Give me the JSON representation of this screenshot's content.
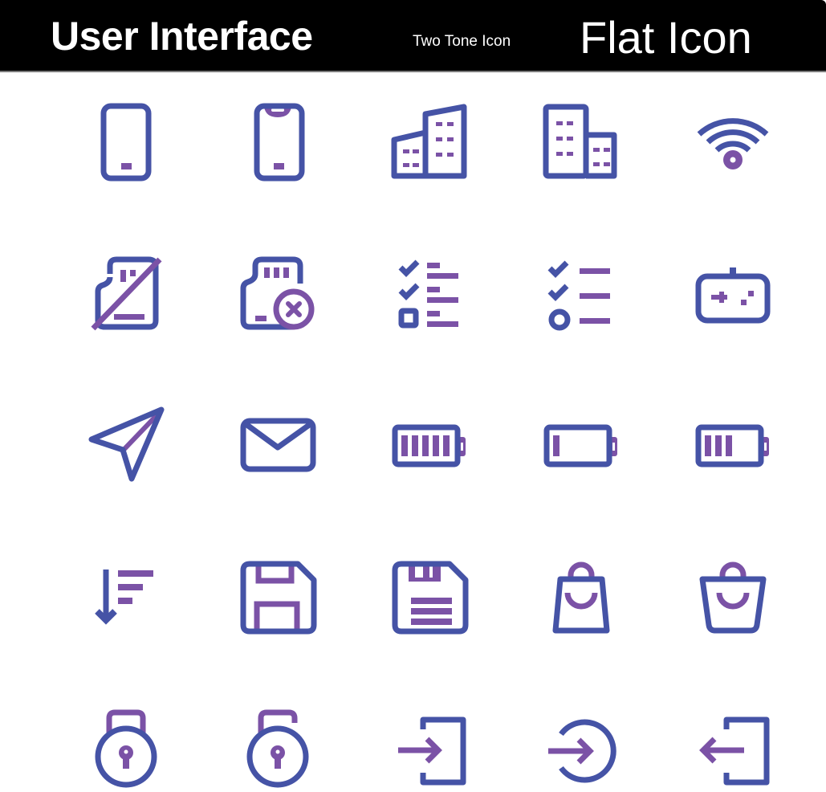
{
  "header": {
    "title": "User Interface",
    "subtitle": "Two Tone Icon",
    "right_title": "Flat Icon"
  },
  "colors": {
    "primary": "#4553a6",
    "accent": "#7b52a6",
    "header_bg": "#000000",
    "header_text": "#ffffff",
    "background": "#ffffff"
  },
  "icons": [
    {
      "name": "smartphone"
    },
    {
      "name": "smartphone-notch"
    },
    {
      "name": "buildings-slanted"
    },
    {
      "name": "buildings"
    },
    {
      "name": "wifi"
    },
    {
      "name": "sd-card-off"
    },
    {
      "name": "sd-card-remove"
    },
    {
      "name": "checklist-boxes"
    },
    {
      "name": "checklist-lines"
    },
    {
      "name": "gamepad"
    },
    {
      "name": "send"
    },
    {
      "name": "mail"
    },
    {
      "name": "battery-full",
      "level": 5,
      "max": 5
    },
    {
      "name": "battery-low",
      "level": 1,
      "max": 5
    },
    {
      "name": "battery-medium",
      "level": 3,
      "max": 5
    },
    {
      "name": "sort-descending"
    },
    {
      "name": "floppy-save"
    },
    {
      "name": "floppy-document"
    },
    {
      "name": "shopping-bag"
    },
    {
      "name": "shopping-basket"
    },
    {
      "name": "lock-locked"
    },
    {
      "name": "lock-unlocked"
    },
    {
      "name": "login"
    },
    {
      "name": "sign-in-circle"
    },
    {
      "name": "logout"
    }
  ]
}
